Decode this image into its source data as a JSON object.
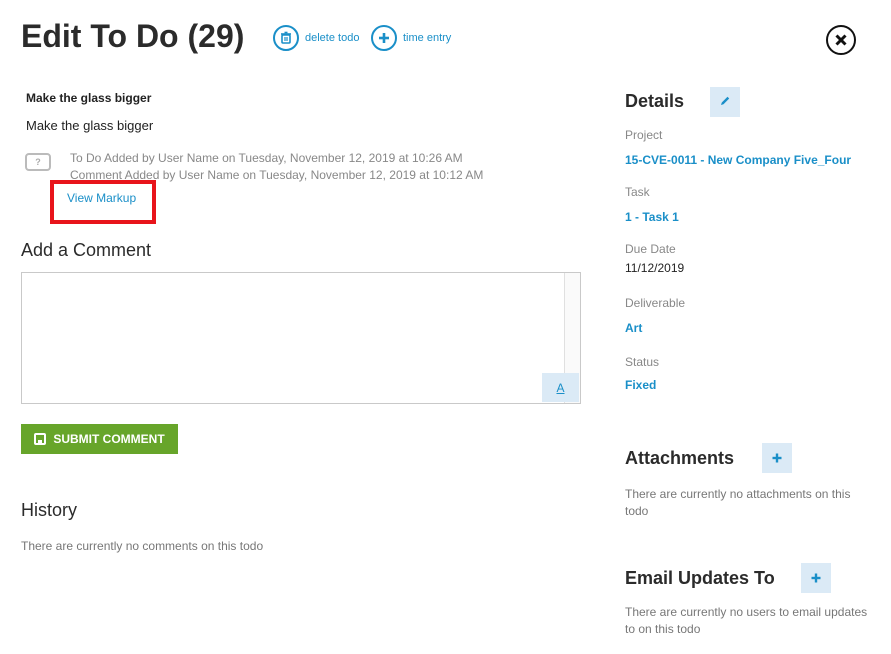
{
  "header": {
    "title": "Edit To Do (29)",
    "delete_label": "delete todo",
    "time_entry_label": "time entry"
  },
  "todo": {
    "title": "Make the glass bigger",
    "description": "Make the glass bigger",
    "activity": [
      "To Do Added by User Name on Tuesday, November 12, 2019 at 10:26 AM",
      "Comment Added by User Name on Tuesday, November 12, 2019 at 10:12 AM"
    ],
    "view_markup_label": "View Markup"
  },
  "comment": {
    "heading": "Add a Comment",
    "value": "",
    "format_label": "A",
    "submit_label": "SUBMIT COMMENT"
  },
  "history": {
    "heading": "History",
    "empty_text": "There are currently no comments on this todo"
  },
  "details": {
    "heading": "Details",
    "project_label": "Project",
    "project_value": "15-CVE-0011 - New Company Five_Four",
    "task_label": "Task",
    "task_value": "1 - Task 1",
    "due_label": "Due Date",
    "due_value": "11/12/2019",
    "deliverable_label": "Deliverable",
    "deliverable_value": "Art",
    "status_label": "Status",
    "status_value": "Fixed"
  },
  "attachments": {
    "heading": "Attachments",
    "empty_text": "There are currently no attachments on this todo"
  },
  "email_updates": {
    "heading": "Email Updates To",
    "empty_text": "There are currently no users to email updates to on this todo"
  },
  "icons": {
    "delete": "trash-icon",
    "time_entry": "plus-icon",
    "close": "close-icon",
    "comment": "comment-icon",
    "edit": "pencil-icon",
    "add": "plus-icon",
    "save": "save-icon"
  },
  "colors": {
    "accent": "#1a8fc8",
    "submit": "#67a52a",
    "highlight": "#e8141b",
    "button_bg": "#dbeaf6"
  }
}
